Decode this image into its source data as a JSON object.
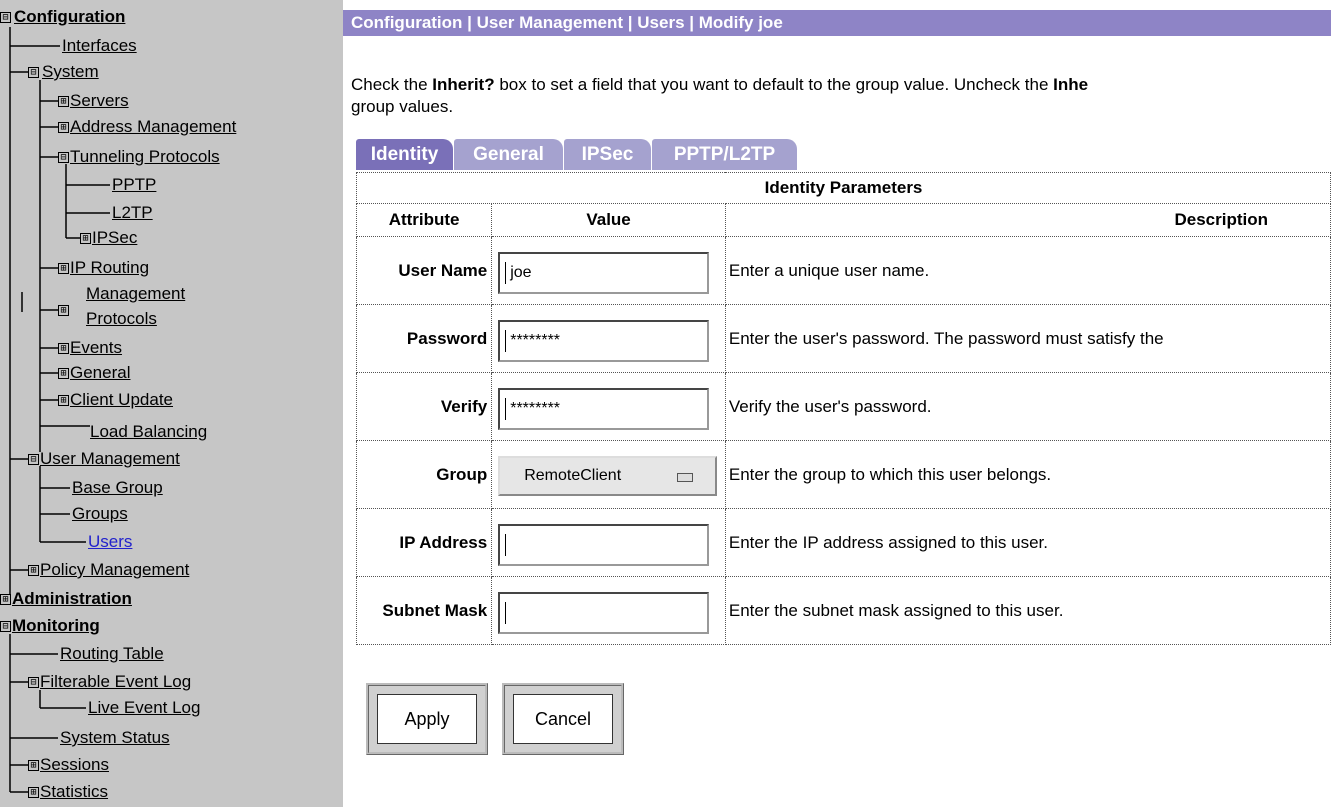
{
  "sidebar": {
    "items": [
      {
        "label": "Configuration",
        "bold": true
      },
      {
        "label": "Interfaces"
      },
      {
        "label": "System"
      },
      {
        "label": "Servers"
      },
      {
        "label": "Address Management"
      },
      {
        "label": "Tunneling Protocols"
      },
      {
        "label": "PPTP"
      },
      {
        "label": "L2TP"
      },
      {
        "label": "IPSec"
      },
      {
        "label": "IP Routing"
      },
      {
        "label": "Management"
      },
      {
        "label": "Protocols"
      },
      {
        "label": "Events"
      },
      {
        "label": "General"
      },
      {
        "label": "Client Update"
      },
      {
        "label": "Load Balancing"
      },
      {
        "label": "User Management"
      },
      {
        "label": "Base Group"
      },
      {
        "label": "Groups"
      },
      {
        "label": "Users"
      },
      {
        "label": "Policy Management"
      },
      {
        "label": "Administration",
        "bold": true
      },
      {
        "label": "Monitoring",
        "bold": true
      },
      {
        "label": "Routing Table"
      },
      {
        "label": "Filterable Event Log"
      },
      {
        "label": "Live Event Log"
      },
      {
        "label": "System Status"
      },
      {
        "label": "Sessions"
      },
      {
        "label": "Statistics"
      }
    ],
    "expand_glyph": "⊞",
    "collapse_glyph": "⊟"
  },
  "main": {
    "breadcrumb": "Configuration | User Management | Users | Modify joe",
    "instructions": {
      "l1a": "Check the ",
      "l1b": "Inherit?",
      "l1c": " box to set a field that you want to default to the group value. Uncheck the ",
      "l1d": "Inhe",
      "l2": "group values."
    },
    "tabs": [
      "Identity",
      "General",
      "IPSec",
      "PPTP/L2TP"
    ],
    "table": {
      "title": "Identity Parameters",
      "headers": {
        "attribute": "Attribute",
        "value": "Value",
        "description": "Description"
      },
      "rows": [
        {
          "attr": "User Name",
          "value": "joe",
          "desc": "Enter a unique user name."
        },
        {
          "attr": "Password",
          "value": "********",
          "desc": "Enter the user's password. The password must satisfy the"
        },
        {
          "attr": "Verify",
          "value": "********",
          "desc": "Verify the user's password."
        },
        {
          "attr": "Group",
          "value": "RemoteClient",
          "desc": "Enter the group to which this user belongs."
        },
        {
          "attr": "IP Address",
          "value": "",
          "desc": "Enter the IP address assigned to this user."
        },
        {
          "attr": "Subnet Mask",
          "value": "",
          "desc": "Enter the subnet mask assigned to this user."
        }
      ]
    },
    "buttons": {
      "apply": "Apply",
      "cancel": "Cancel"
    }
  },
  "colors": {
    "sidebar_bg": "#c6c6c6",
    "titlebar_bg": "#8e84c6",
    "tab_active": "#7a70b8",
    "tab_inactive": "#a5a2cf",
    "active_link": "#2222cc"
  }
}
